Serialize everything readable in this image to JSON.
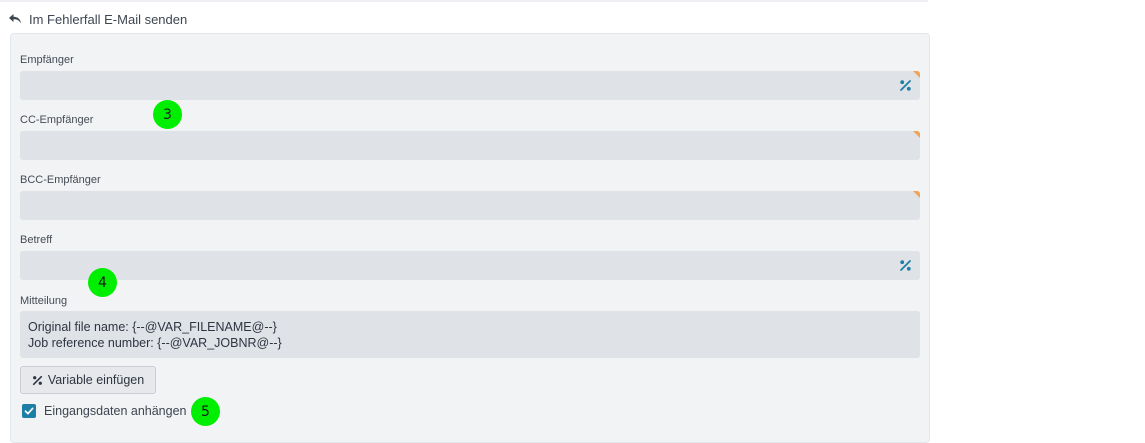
{
  "section": {
    "title": "Im Fehlerfall E-Mail senden"
  },
  "fields": {
    "recipient": {
      "label": "Empfänger",
      "value": ""
    },
    "cc": {
      "label": "CC-Empfänger",
      "value": ""
    },
    "bcc": {
      "label": "BCC-Empfänger",
      "value": ""
    },
    "subject": {
      "label": "Betreff",
      "value": ""
    },
    "message": {
      "label": "Mitteilung",
      "lines": [
        "Original file name: {--@VAR_FILENAME@--}",
        "Job reference number: {--@VAR_JOBNR@--}"
      ]
    }
  },
  "insert_variable_button": {
    "label": "Variable einfügen"
  },
  "attach_input": {
    "label": "Eingangsdaten anhängen",
    "checked": true
  },
  "markers": [
    "3",
    "4",
    "5"
  ],
  "colors": {
    "accent": "#1e7fa6",
    "marker": "#00ef00",
    "flag": "#f0a45a",
    "input_bg": "#dfe2e7",
    "panel_bg": "#f2f3f5"
  },
  "icons": {
    "header": "undo-arrow-icon",
    "variable": "percent-icon",
    "checkbox": "check-icon"
  }
}
